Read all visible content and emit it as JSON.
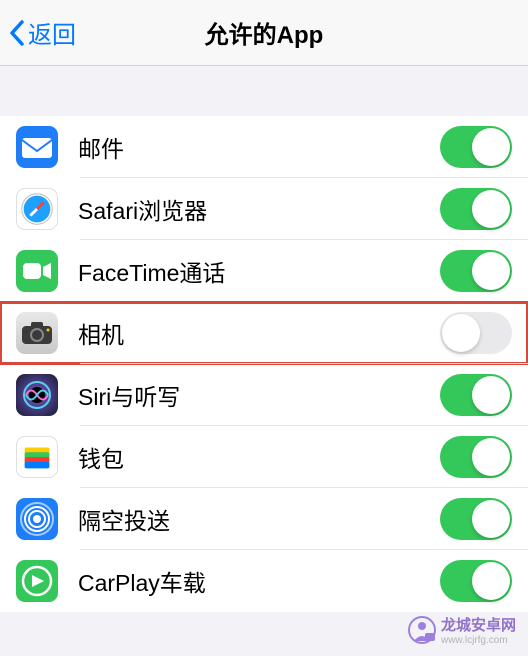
{
  "header": {
    "back_label": "返回",
    "title": "允许的App"
  },
  "apps": [
    {
      "id": "mail",
      "label": "邮件",
      "enabled": true,
      "highlighted": false,
      "icon": "mail-icon"
    },
    {
      "id": "safari",
      "label": "Safari浏览器",
      "enabled": true,
      "highlighted": false,
      "icon": "safari-icon"
    },
    {
      "id": "facetime",
      "label": "FaceTime通话",
      "enabled": true,
      "highlighted": false,
      "icon": "facetime-icon"
    },
    {
      "id": "camera",
      "label": "相机",
      "enabled": false,
      "highlighted": true,
      "icon": "camera-icon"
    },
    {
      "id": "siri",
      "label": "Siri与听写",
      "enabled": true,
      "highlighted": false,
      "icon": "siri-icon"
    },
    {
      "id": "wallet",
      "label": "钱包",
      "enabled": true,
      "highlighted": false,
      "icon": "wallet-icon"
    },
    {
      "id": "airdrop",
      "label": "隔空投送",
      "enabled": true,
      "highlighted": false,
      "icon": "airdrop-icon"
    },
    {
      "id": "carplay",
      "label": "CarPlay车载",
      "enabled": true,
      "highlighted": false,
      "icon": "carplay-icon"
    }
  ],
  "watermark": {
    "text": "龙城安卓网",
    "url": "www.lcjrfg.com"
  },
  "colors": {
    "toggle_on": "#34c759",
    "toggle_off": "#e9e9eb",
    "accent": "#007aff",
    "highlight_border": "#d9463a"
  }
}
